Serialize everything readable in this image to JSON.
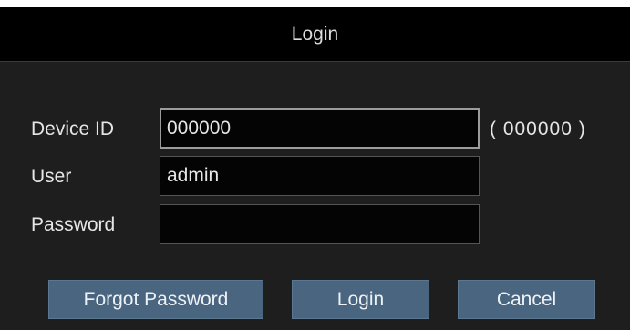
{
  "dialog": {
    "title": "Login"
  },
  "form": {
    "device_id": {
      "label": "Device ID",
      "value": "000000",
      "hint": "( 000000 )"
    },
    "user": {
      "label": "User",
      "value": "admin"
    },
    "password": {
      "label": "Password",
      "value": ""
    }
  },
  "buttons": {
    "forgot_password": "Forgot Password",
    "login": "Login",
    "cancel": "Cancel"
  },
  "colors": {
    "title_bar": "#000000",
    "dialog_background": "#1e1e1e",
    "input_background": "#040404",
    "button_background": "#4a657f",
    "text": "#e6e6e6"
  }
}
